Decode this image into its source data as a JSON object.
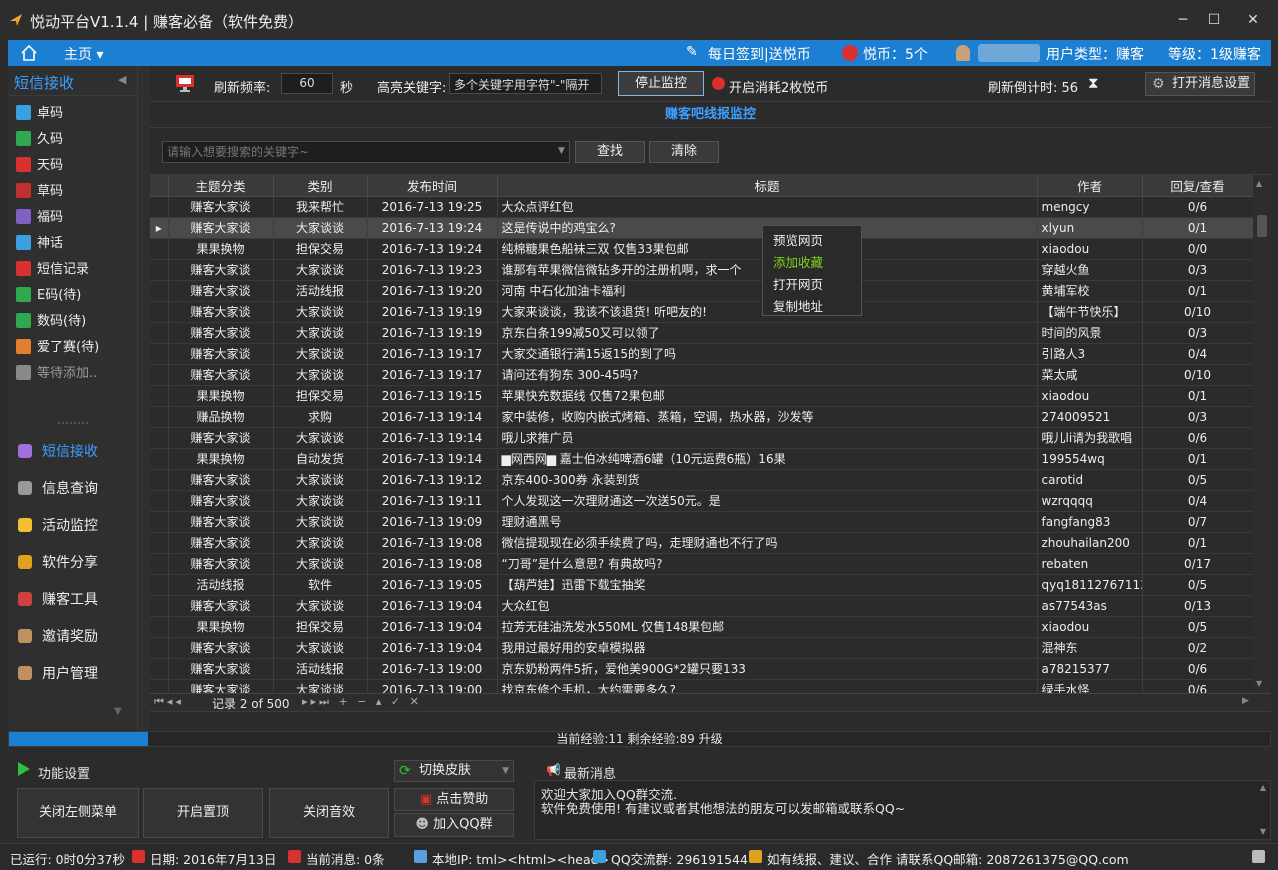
{
  "window": {
    "title": "悦动平台V1.1.4 | 赚客必备（软件免费）",
    "minimize": "─",
    "maximize": "☐",
    "close": "✕"
  },
  "menubar": {
    "home": "主页 ▾",
    "signin": "每日签到|送悦币",
    "coins": "悦币：5个",
    "user_type": "用户类型：赚客",
    "level": "等级：1级赚客"
  },
  "sidebar": {
    "header": "短信接收",
    "codes": [
      {
        "label": "卓码",
        "color": "#3aa0e0"
      },
      {
        "label": "久码",
        "color": "#2fa84f"
      },
      {
        "label": "天码",
        "color": "#d93030"
      },
      {
        "label": "草码",
        "color": "#c03030"
      },
      {
        "label": "福码",
        "color": "#8060c0"
      },
      {
        "label": "神话",
        "color": "#3aa0e0"
      },
      {
        "label": "短信记录",
        "color": "#d93030"
      },
      {
        "label": "E码(待)",
        "color": "#2fa84f"
      },
      {
        "label": "数码(待)",
        "color": "#2fa84f"
      },
      {
        "label": "爱了赛(待)",
        "color": "#e08030"
      },
      {
        "label": "等待添加..",
        "color": "#888888"
      }
    ],
    "modules": [
      {
        "label": "短信接收",
        "color": "#a070e0",
        "active": true
      },
      {
        "label": "信息查询",
        "color": "#999999"
      },
      {
        "label": "活动监控",
        "color": "#f0c030"
      },
      {
        "label": "软件分享",
        "color": "#e0a020"
      },
      {
        "label": "赚客工具",
        "color": "#d04040"
      },
      {
        "label": "邀请奖励",
        "color": "#c09060"
      },
      {
        "label": "用户管理",
        "color": "#c09060"
      }
    ]
  },
  "toolbar": {
    "refresh_label": "刷新频率:",
    "refresh_value": "60",
    "refresh_unit": "秒",
    "keyword_label": "高亮关键字:",
    "keyword_value": "多个关键字用字符\"-\"隔开",
    "stop_button": "停止监控",
    "coin_option": "开启消耗2枚悦币",
    "countdown": "刷新倒计时: 56",
    "settings_button": "打开消息设置"
  },
  "panel_title": "赚客吧线报监控",
  "search": {
    "placeholder": "请输入想要搜索的关键字~",
    "find": "查找",
    "clear": "清除"
  },
  "grid": {
    "columns": [
      "主题分类",
      "类别",
      "发布时间",
      "标题",
      "作者",
      "回复/查看"
    ],
    "rows": [
      [
        "赚客大家谈",
        "我来帮忙",
        "2016-7-13 19:25",
        "大众点评红包",
        "mengcy",
        "0/6"
      ],
      [
        "赚客大家谈",
        "大家谈谈",
        "2016-7-13 19:24",
        "这是传说中的鸡宝么?",
        "xlyun",
        "0/1"
      ],
      [
        "果果换物",
        "担保交易",
        "2016-7-13 19:24",
        "纯棉糖果色船袜三双 仅售33果包邮",
        "xiaodou",
        "0/0"
      ],
      [
        "赚客大家谈",
        "大家谈谈",
        "2016-7-13 19:23",
        "谁那有苹果微信微钻多开的注册机啊，求一个",
        "穿越火鱼",
        "0/3"
      ],
      [
        "赚客大家谈",
        "活动线报",
        "2016-7-13 19:20",
        "河南 中石化加油卡福利",
        "黄埔军校",
        "0/1"
      ],
      [
        "赚客大家谈",
        "大家谈谈",
        "2016-7-13 19:19",
        "大家来谈谈，我该不该退货! 听吧友的!",
        "【端午节快乐】",
        "0/10"
      ],
      [
        "赚客大家谈",
        "大家谈谈",
        "2016-7-13 19:19",
        "京东白条199减50又可以领了",
        "时间的风景",
        "0/3"
      ],
      [
        "赚客大家谈",
        "大家谈谈",
        "2016-7-13 19:17",
        "大家交通银行满15返15的到了吗",
        "引路人3",
        "0/4"
      ],
      [
        "赚客大家谈",
        "大家谈谈",
        "2016-7-13 19:17",
        "请问还有狗东 300-45吗?",
        "菜太咸",
        "0/10"
      ],
      [
        "果果换物",
        "担保交易",
        "2016-7-13 19:15",
        "苹果快充数据线 仅售72果包邮",
        "xiaodou",
        "0/1"
      ],
      [
        "赚品换物",
        "求购",
        "2016-7-13 19:14",
        "家中装修，收购内嵌式烤箱、蒸箱，空调，热水器，沙发等",
        "274009521",
        "0/3"
      ],
      [
        "赚客大家谈",
        "大家谈谈",
        "2016-7-13 19:14",
        "哦儿求推广员",
        "哦儿li请为我歌唱",
        "0/6"
      ],
      [
        "果果换物",
        "自动发货",
        "2016-7-13 19:14",
        "▆网西网▆ 嘉士伯冰纯啤酒6罐（10元运费6瓶）16果",
        "199554wq",
        "0/1"
      ],
      [
        "赚客大家谈",
        "大家谈谈",
        "2016-7-13 19:12",
        "京东400-300券 永装到货",
        "carotid",
        "0/5"
      ],
      [
        "赚客大家谈",
        "大家谈谈",
        "2016-7-13 19:11",
        "个人发现这一次理财通这一次送50元。是",
        "wzrqqqq",
        "0/4"
      ],
      [
        "赚客大家谈",
        "大家谈谈",
        "2016-7-13 19:09",
        "理财通黑号",
        "fangfang83",
        "0/7"
      ],
      [
        "赚客大家谈",
        "大家谈谈",
        "2016-7-13 19:08",
        "微信提现现在必须手续费了吗，走理财通也不行了吗",
        "zhouhailan200",
        "0/1"
      ],
      [
        "赚客大家谈",
        "大家谈谈",
        "2016-7-13 19:08",
        "“刀哥”是什么意思? 有典故吗?",
        "rebaten",
        "0/17"
      ],
      [
        "活动线报",
        "软件",
        "2016-7-13 19:05",
        "【葫芦娃】迅雷下载宝抽奖",
        "qyq18112767113",
        "0/5"
      ],
      [
        "赚客大家谈",
        "大家谈谈",
        "2016-7-13 19:04",
        "大众红包",
        "as77543as",
        "0/13"
      ],
      [
        "果果换物",
        "担保交易",
        "2016-7-13 19:04",
        "拉芳无硅油洗发水550ML 仅售148果包邮",
        "xiaodou",
        "0/5"
      ],
      [
        "赚客大家谈",
        "大家谈谈",
        "2016-7-13 19:04",
        "我用过最好用的安卓模拟器",
        "混神东",
        "0/2"
      ],
      [
        "赚客大家谈",
        "活动线报",
        "2016-7-13 19:00",
        "京东奶粉两件5折，爱他美900G*2罐只要133",
        "a78215377",
        "0/6"
      ],
      [
        "赚客大家谈",
        "大家谈谈",
        "2016-7-13 19:00",
        "找京东修个手机，大约需要多久?",
        "绿手水怪",
        "0/6"
      ]
    ],
    "selected_row": 1,
    "nav_text": "记录 2 of 500"
  },
  "context_menu": [
    "预览网页",
    "添加收藏",
    "打开网页",
    "复制地址"
  ],
  "progress": {
    "text": "当前经验:11 剩余经验:89 升级",
    "fraction": 0.11
  },
  "functions": {
    "header": "功能设置",
    "skin": "切换皮肤",
    "close_menu": "关闭左侧菜单",
    "pin": "开启置顶",
    "sound": "关闭音效",
    "donate": "点击赞助",
    "qq_group": "加入QQ群"
  },
  "news": {
    "header": "最新消息",
    "lines": [
      "欢迎大家加入QQ群交流.",
      "软件免费使用! 有建议或者其他想法的朋友可以发邮箱或联系QQ~"
    ]
  },
  "statusbar": {
    "runtime": "已运行: 0时0分37秒",
    "date": "日期: 2016年7月13日",
    "messages": "当前消息: 0条",
    "ip": "本地IP: tml><html><head>",
    "qq_group": "QQ交流群: 296191544",
    "contact": "如有线报、建议、合作 请联系QQ邮箱: 2087261375@QQ.com"
  },
  "colors": {
    "accent": "#1d7fd1",
    "panel_title": "#3aa0ff",
    "context_highlight": "#7ed321"
  }
}
